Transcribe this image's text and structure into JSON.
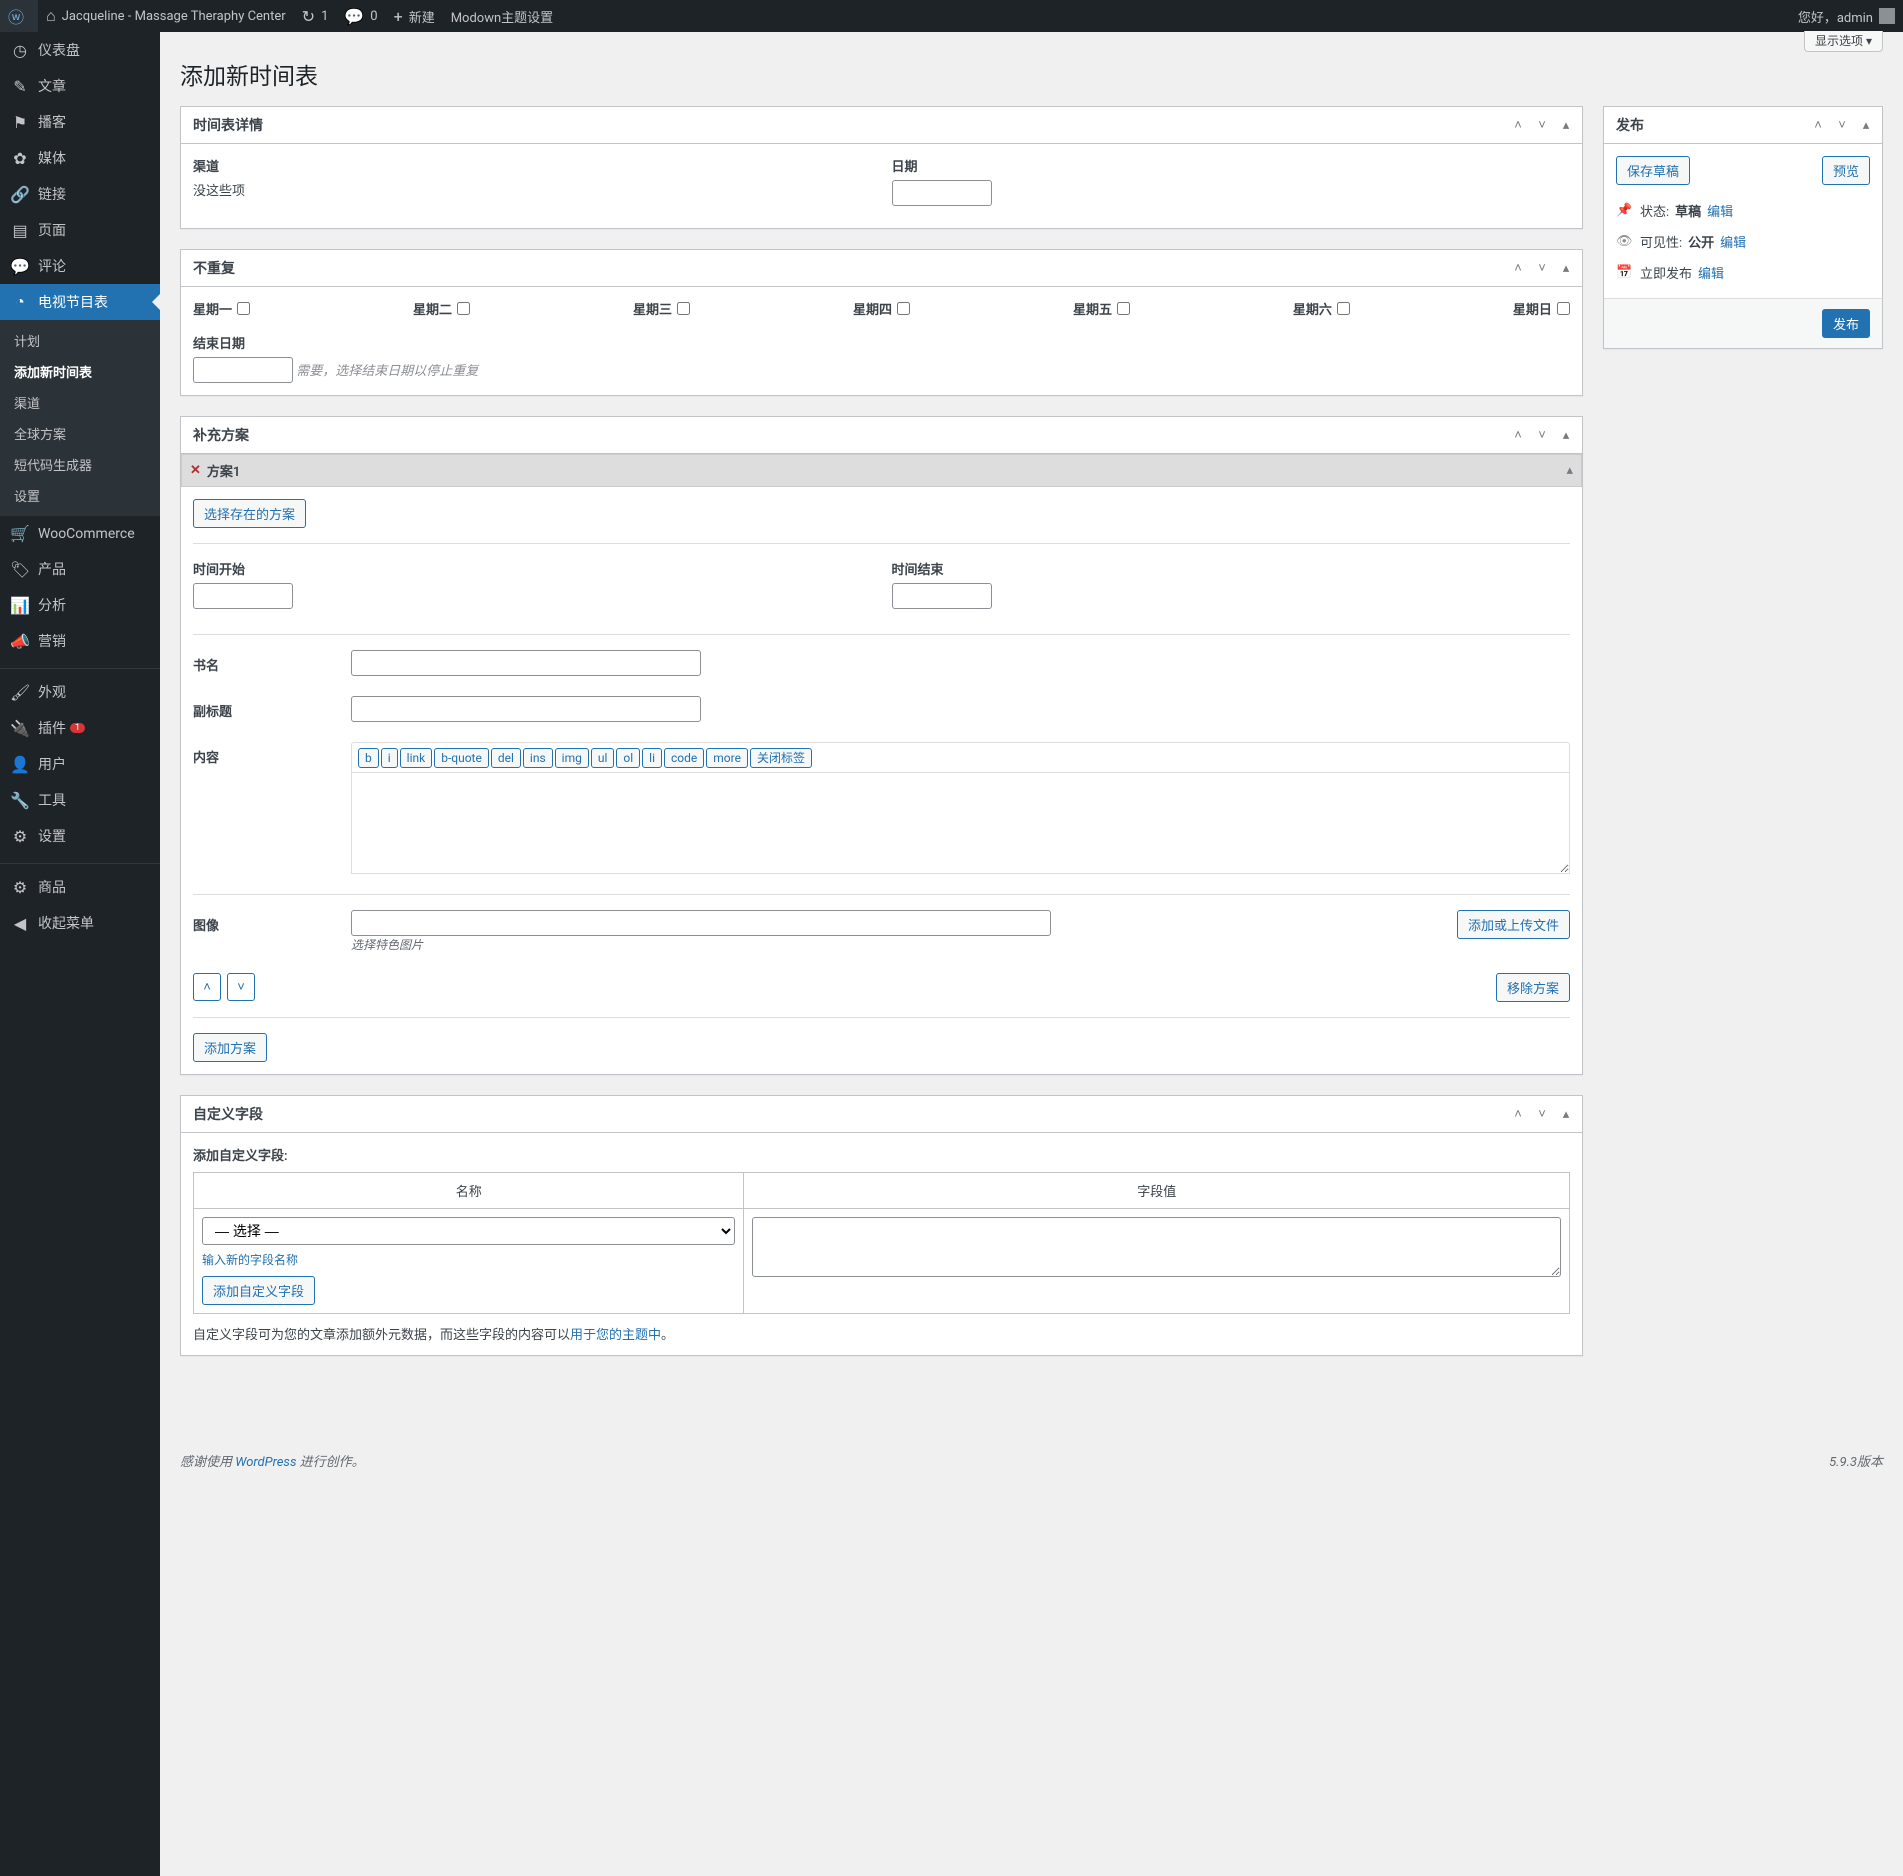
{
  "topbar": {
    "site_name": "Jacqueline - Massage Theraphy Center",
    "updates_count": "1",
    "comments_count": "0",
    "new_label": "新建",
    "modown_label": "Modown主题设置",
    "greeting": "您好，admin",
    "screen_options": "显示选项 ▾"
  },
  "sidebar": {
    "items": [
      {
        "icon": "◷",
        "label": "仪表盘"
      },
      {
        "icon": "✎",
        "label": "文章"
      },
      {
        "icon": "⚑",
        "label": "播客"
      },
      {
        "icon": "✿",
        "label": "媒体"
      },
      {
        "icon": "🔗",
        "label": "链接"
      },
      {
        "icon": "▤",
        "label": "页面"
      },
      {
        "icon": "💬",
        "label": "评论"
      },
      {
        "icon": "◔",
        "label": "电视节目表",
        "current": true
      }
    ],
    "submenu": [
      {
        "label": "计划"
      },
      {
        "label": "添加新时间表",
        "current": true
      },
      {
        "label": "渠道"
      },
      {
        "label": "全球方案"
      },
      {
        "label": "短代码生成器"
      },
      {
        "label": "设置"
      }
    ],
    "items2": [
      {
        "icon": "🛒",
        "label": "WooCommerce"
      },
      {
        "icon": "🏷",
        "label": "产品"
      },
      {
        "icon": "📊",
        "label": "分析"
      },
      {
        "icon": "📣",
        "label": "营销"
      }
    ],
    "items3": [
      {
        "icon": "🖌",
        "label": "外观"
      },
      {
        "icon": "🔌",
        "label": "插件",
        "badge": "1"
      },
      {
        "icon": "👤",
        "label": "用户"
      },
      {
        "icon": "🔧",
        "label": "工具"
      },
      {
        "icon": "⚙",
        "label": "设置"
      }
    ],
    "items4": [
      {
        "icon": "⚙",
        "label": "商品"
      },
      {
        "icon": "◀",
        "label": "收起菜单"
      }
    ]
  },
  "page_title": "添加新时间表",
  "details_box": {
    "title": "时间表详情",
    "channel_label": "渠道",
    "channel_empty": "没这些项",
    "date_label": "日期"
  },
  "repeat_box": {
    "title": "不重复",
    "days": [
      "星期一",
      "星期二",
      "星期三",
      "星期四",
      "星期五",
      "星期六",
      "星期日"
    ],
    "end_date_label": "结束日期",
    "end_date_hint": "需要，选择结束日期以停止重复"
  },
  "scheme_box": {
    "title": "补充方案",
    "scheme_label": "方案1",
    "select_existing": "选择存在的方案",
    "time_start": "时间开始",
    "time_end": "时间结束",
    "name_label": "书名",
    "subtitle_label": "副标题",
    "content_label": "内容",
    "image_label": "图像",
    "image_hint": "选择特色图片",
    "upload_btn": "添加或上传文件",
    "remove_btn": "移除方案",
    "add_btn": "添加方案",
    "qt_buttons": [
      "b",
      "i",
      "link",
      "b-quote",
      "del",
      "ins",
      "img",
      "ul",
      "ol",
      "li",
      "code",
      "more",
      "关闭标签"
    ]
  },
  "custom_fields": {
    "title": "自定义字段",
    "add_heading": "添加自定义字段:",
    "name_col": "名称",
    "value_col": "字段值",
    "select_default": "— 选择 —",
    "enter_new": "输入新的字段名称",
    "add_btn": "添加自定义字段",
    "desc_prefix": "自定义字段可为您的文章添加额外元数据，而这些字段的内容可以",
    "desc_link": "用于您的主题中",
    "desc_suffix": "。"
  },
  "publish": {
    "title": "发布",
    "save_draft": "保存草稿",
    "preview": "预览",
    "status_label": "状态:",
    "status_value": "草稿",
    "visibility_label": "可见性:",
    "visibility_value": "公开",
    "publish_label": "立即发布",
    "edit": "编辑",
    "publish_btn": "发布"
  },
  "footer": {
    "thanks_prefix": "感谢使用 ",
    "thanks_link": "WordPress",
    "thanks_suffix": " 进行创作。",
    "version": "5.9.3版本"
  }
}
